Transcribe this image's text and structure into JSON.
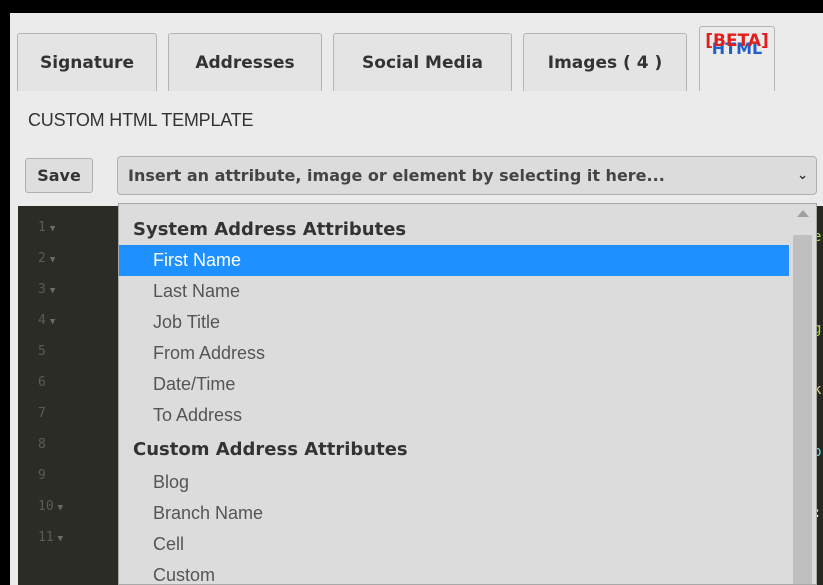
{
  "tabs": [
    {
      "label": "Signature"
    },
    {
      "label": "Addresses"
    },
    {
      "label": "Social Media"
    },
    {
      "label": "Images ( 4 )"
    },
    {
      "label": "HTML",
      "badge": "[BETA]"
    }
  ],
  "section_title": "CUSTOM HTML TEMPLATE",
  "toolbar": {
    "save_label": "Save",
    "select_placeholder": "Insert an attribute, image or element by selecting it here..."
  },
  "editor": {
    "line_numbers": [
      "1",
      "2",
      "3",
      "4",
      "5",
      "6",
      "7",
      "8",
      "9",
      "10",
      "11"
    ],
    "fold_lines": [
      1,
      2,
      3,
      4,
      10,
      11
    ],
    "edge_chars": [
      "e",
      "g",
      "k",
      "p",
      ":"
    ]
  },
  "dropdown": {
    "groups": [
      {
        "label": "System Address Attributes",
        "items": [
          "First Name",
          "Last Name",
          "Job Title",
          "From Address",
          "Date/Time",
          "To Address"
        ]
      },
      {
        "label": "Custom Address Attributes",
        "items": [
          "Blog",
          "Branch Name",
          "Cell",
          "Custom"
        ]
      }
    ],
    "selected": "First Name"
  },
  "colors": {
    "selected": "#1e90ff",
    "beta": "#e01e1e",
    "html_tab": "#1f5fc8",
    "editor_bg": "#272822"
  }
}
